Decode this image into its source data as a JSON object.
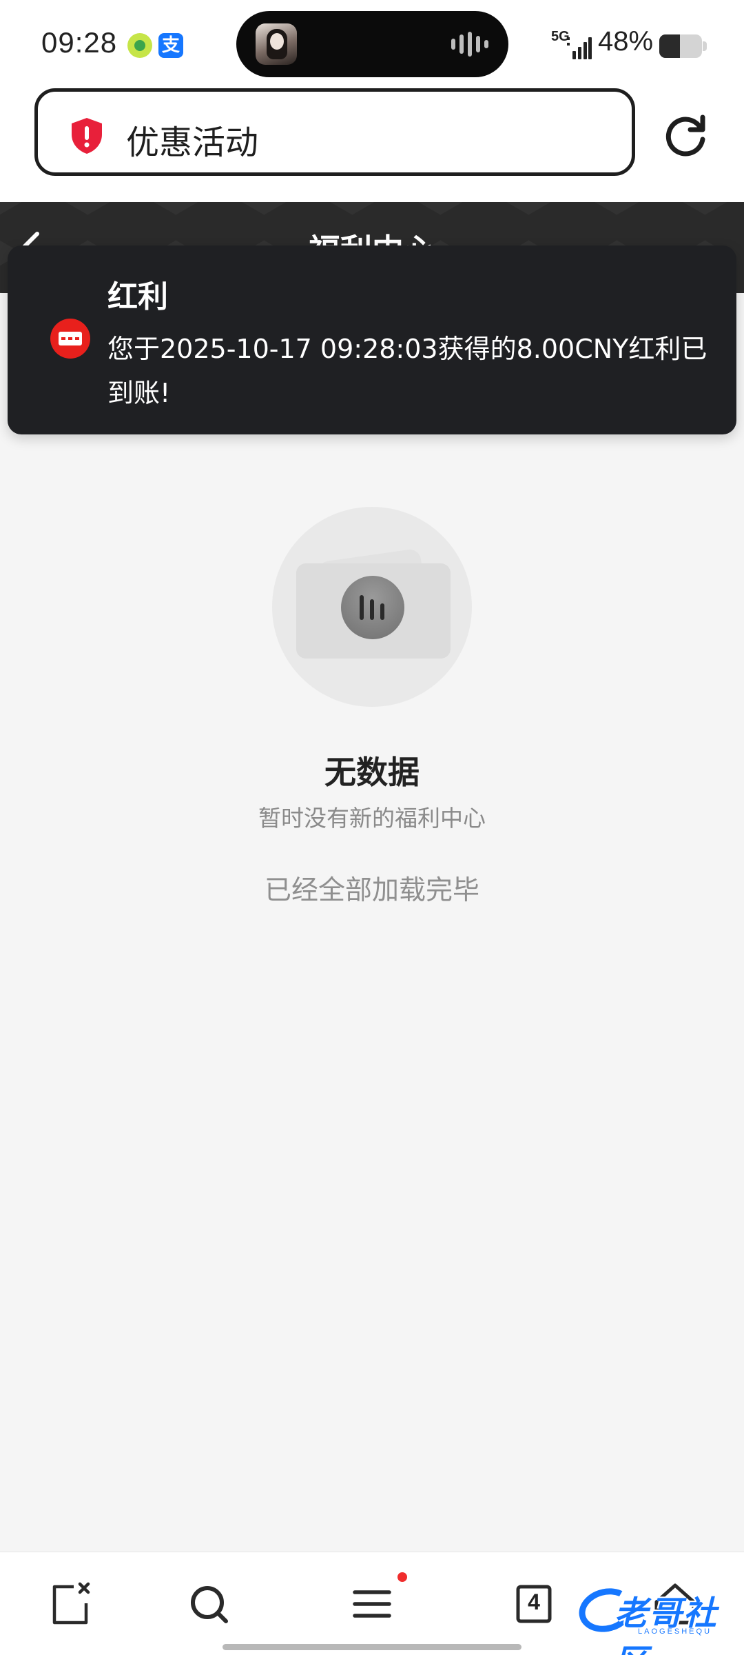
{
  "status_bar": {
    "time": "09:28",
    "network": "5G",
    "battery_percent": "48%",
    "battery_level": 0.48,
    "app_icons": [
      "qq-music-icon",
      "alipay-icon"
    ],
    "alipay_glyph": "支"
  },
  "address_bar": {
    "url_text": "优惠活动",
    "security_icon": "shield-alert-icon",
    "reload_icon": "reload-icon"
  },
  "page_header": {
    "title": "福利中心"
  },
  "toast": {
    "title": "红利",
    "message": "您于2025-10-17 09:28:03获得的8.00CNY红利已到账!",
    "accent_color": "#e8201c"
  },
  "empty_state": {
    "title": "无数据",
    "subtitle": "暂时没有新的福利中心",
    "footer": "已经全部加载完毕"
  },
  "bottom_nav": {
    "items": [
      {
        "name": "close-page-icon"
      },
      {
        "name": "search-icon"
      },
      {
        "name": "menu-icon",
        "has_badge": true
      },
      {
        "name": "tabs-icon",
        "count": "4"
      },
      {
        "name": "home-icon"
      }
    ],
    "badge_color": "#f02d2d"
  },
  "watermark": {
    "text": "老哥社区",
    "subtext": "LAOGESHEQU"
  }
}
